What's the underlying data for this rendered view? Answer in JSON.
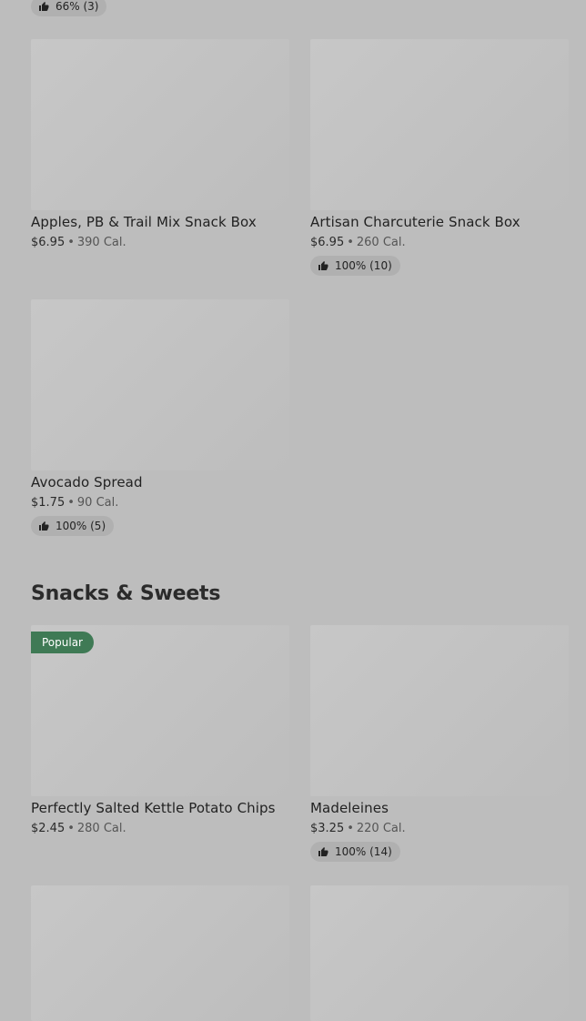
{
  "top_rating": "66% (3)",
  "section_snacks": {
    "title": "Snacks & Sweets"
  },
  "items": [
    {
      "name": "Apples, PB & Trail Mix Snack Box",
      "price": "$6.95",
      "calories": "390 Cal."
    },
    {
      "name": "Artisan Charcuterie Snack Box",
      "price": "$6.95",
      "calories": "260 Cal.",
      "rating": "100% (10)"
    },
    {
      "name": "Avocado Spread",
      "price": "$1.75",
      "calories": "90 Cal.",
      "rating": "100% (5)"
    },
    {
      "name": "Perfectly Salted Kettle Potato Chips",
      "price": "$2.45",
      "calories": "280 Cal.",
      "badge": "Popular"
    },
    {
      "name": "Madeleines",
      "price": "$3.25",
      "calories": "220 Cal.",
      "rating": "100% (14)"
    }
  ],
  "separator": "•",
  "icons": {
    "rating": "thumbs-up-icon"
  },
  "colors": {
    "badge_bg": "#3f7a55",
    "page_bg": "#bdbdbd"
  }
}
